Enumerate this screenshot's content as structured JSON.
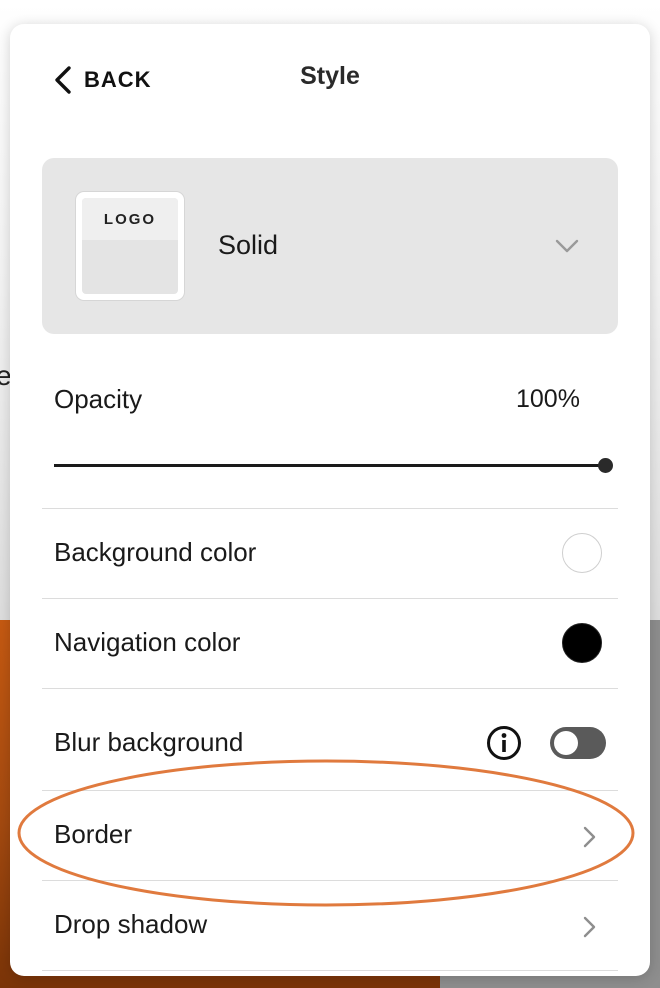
{
  "header": {
    "back_label": "BACK",
    "title": "Style"
  },
  "background": {
    "fragment_text": "e"
  },
  "style_select": {
    "thumb_text": "LOGO",
    "value": "Solid"
  },
  "opacity": {
    "label": "Opacity",
    "value_text": "100%",
    "value": 1.0
  },
  "rows": {
    "background_color": {
      "label": "Background color",
      "color": "#ffffff"
    },
    "navigation_color": {
      "label": "Navigation color",
      "color": "#000000"
    },
    "blur_background": {
      "label": "Blur background",
      "enabled": false
    },
    "border": {
      "label": "Border"
    },
    "drop_shadow": {
      "label": "Drop shadow"
    }
  },
  "annotation": {
    "highlight_color": "#e07a3e"
  }
}
